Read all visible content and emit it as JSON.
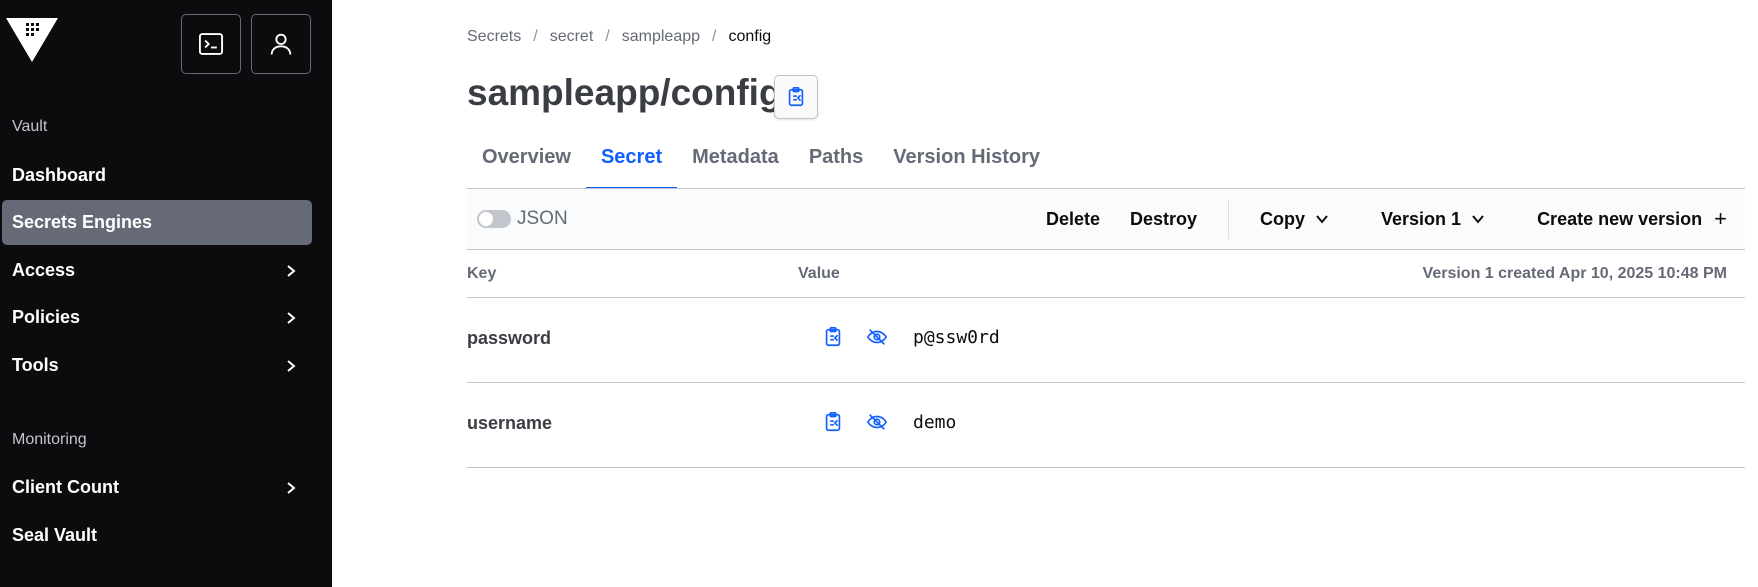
{
  "sidebar": {
    "logo_icon": "vault-logo-icon",
    "console_icon": "terminal-icon",
    "user_icon": "user-icon",
    "section_vault": "Vault",
    "items": [
      {
        "label": "Dashboard"
      },
      {
        "label": "Secrets Engines",
        "active": true
      },
      {
        "label": "Access",
        "chevron": true
      },
      {
        "label": "Policies",
        "chevron": true
      },
      {
        "label": "Tools",
        "chevron": true
      }
    ],
    "section_monitoring": "Monitoring",
    "monitoring_items": [
      {
        "label": "Client Count",
        "chevron": true
      },
      {
        "label": "Seal Vault"
      }
    ]
  },
  "breadcrumb": [
    "Secrets",
    "secret",
    "sampleapp",
    "config"
  ],
  "page": {
    "title": "sampleapp/config"
  },
  "tabs": [
    {
      "label": "Overview"
    },
    {
      "label": "Secret",
      "active": true
    },
    {
      "label": "Metadata"
    },
    {
      "label": "Paths"
    },
    {
      "label": "Version History"
    }
  ],
  "toolbar": {
    "json_toggle_label": "JSON",
    "json_toggle_on": false,
    "delete_label": "Delete",
    "destroy_label": "Destroy",
    "copy_label": "Copy",
    "version_label": "Version 1",
    "create_label": "Create new version",
    "create_symbol": "+"
  },
  "table": {
    "key_header": "Key",
    "value_header": "Value",
    "version_info": "Version 1 created Apr 10, 2025 10:48 PM",
    "rows": [
      {
        "key": "password",
        "value": "p@ssw0rd"
      },
      {
        "key": "username",
        "value": "demo"
      }
    ]
  },
  "colors": {
    "sidebar_bg": "#0c0c0e",
    "active_nav_bg": "#656a76",
    "accent": "#1060ff"
  }
}
